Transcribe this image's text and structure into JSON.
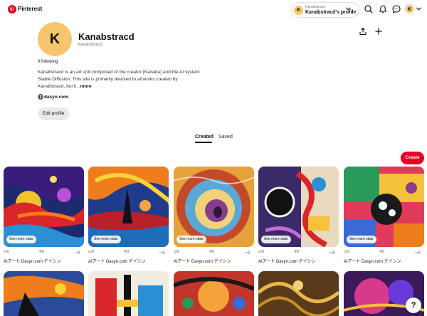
{
  "header": {
    "brand": "Pinterest",
    "menu_glyph": "≡",
    "switcher_small": "Kanabstracd",
    "switcher_main": "Kanabstracd's profile",
    "switcher_initial": "K",
    "avatar_initial": "K",
    "icons": [
      "search-icon",
      "notifications-icon",
      "messages-icon"
    ]
  },
  "profile": {
    "initial": "K",
    "name": "Kanabstracd",
    "handle": "kanabstracd",
    "following": "0 following",
    "bio": "Kanabstracd is an art unit composed of the creator (Kanada) and the AI system Stable Diffusion. This site is primarily devoted to artworks created by Kanabstracd, but it...",
    "bio_more": "more",
    "website": "dasyn.com",
    "edit_label": "Edit profile"
  },
  "tabs": {
    "created": "Created",
    "saved": "Saved"
  },
  "create_label": "Create",
  "pins": [
    {
      "stats_label": "See more stats",
      "views": "0",
      "saves": "0",
      "clicks": "0",
      "title": "AIアート Dasyn.com デイシン"
    },
    {
      "stats_label": "See more stats",
      "views": "0",
      "saves": "0",
      "clicks": "0",
      "title": "AIアート Dasyn.com デイシン"
    },
    {
      "stats_label": "See more stats",
      "views": "0",
      "saves": "0",
      "clicks": "0",
      "title": "AIアート Dasyn.com デイシン"
    },
    {
      "stats_label": "See more stats",
      "views": "0",
      "saves": "0",
      "clicks": "0",
      "title": "AIアート Dasyn.com デイシン"
    },
    {
      "stats_label": "See more stats",
      "views": "0",
      "saves": "0",
      "clicks": "0",
      "title": "AIアート Dasyn.com デイシン"
    }
  ],
  "help_label": "?",
  "colors": {
    "brand_red": "#e60023",
    "avatar_yellow": "#f5c66e"
  }
}
